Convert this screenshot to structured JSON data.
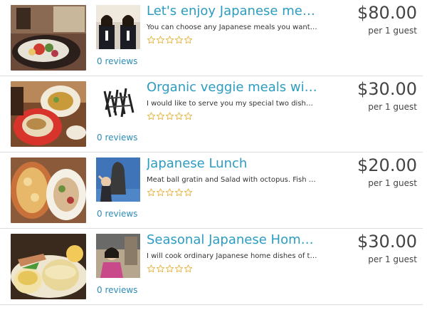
{
  "listings": [
    {
      "title": "Let's enjoy Japanese meals a…",
      "description": "You can choose any Japanese meals you want; S…",
      "reviews_label": "0 reviews",
      "rating": 0,
      "price": "$80.00",
      "per_guest": "per 1 guest"
    },
    {
      "title": "Organic veggie meals with bi…",
      "description": "I would like to serve you my special two dishes - a…",
      "reviews_label": "0 reviews",
      "rating": 0,
      "price": "$30.00",
      "per_guest": "per 1 guest"
    },
    {
      "title": "Japanese Lunch",
      "description": "Meat ball gratin and Salad with octopus. Fish Pla…",
      "reviews_label": "0 reviews",
      "rating": 0,
      "price": "$20.00",
      "per_guest": "per 1 guest"
    },
    {
      "title": "Seasonal Japanese Home Co…",
      "description": "I will cook ordinary Japanese home dishes of the s…",
      "reviews_label": "0 reviews",
      "rating": 0,
      "price": "$30.00",
      "per_guest": "per 1 guest"
    }
  ],
  "star_count": 5,
  "colors": {
    "title": "#2c9cc0",
    "link": "#2c8cb8",
    "star_outline": "#e3b341",
    "price": "#444444"
  }
}
